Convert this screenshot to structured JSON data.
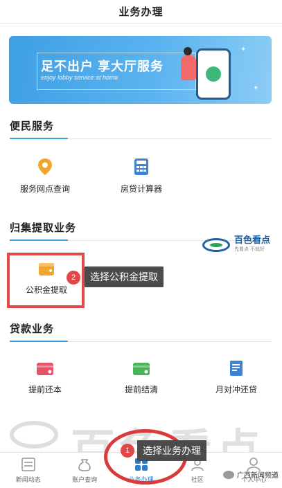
{
  "header": {
    "title": "业务办理"
  },
  "banner": {
    "main_text": "足不出户 享大厅服务",
    "sub_text": "enjoy lobby service at home"
  },
  "sections": {
    "convenience": {
      "title": "便民服务",
      "items": [
        {
          "label": "服务网点查询",
          "icon": "location-pin-icon"
        },
        {
          "label": "房贷计算器",
          "icon": "calculator-icon"
        }
      ]
    },
    "withdraw": {
      "title": "归集提取业务",
      "items": [
        {
          "label": "公积金提取",
          "icon": "wallet-icon"
        }
      ]
    },
    "loan": {
      "title": "贷款业务",
      "items": [
        {
          "label": "提前还本",
          "icon": "card-icon"
        },
        {
          "label": "提前结清",
          "icon": "card-check-icon"
        },
        {
          "label": "月对冲还贷",
          "icon": "document-icon"
        }
      ]
    }
  },
  "annotations": {
    "step2": {
      "number": "2",
      "text": "选择公积金提取"
    },
    "step1": {
      "number": "1",
      "text": "选择业务办理"
    }
  },
  "watermark": {
    "logo_text": "百色看点",
    "logo_sub": "先看点 不就好",
    "big_text": "百色看点",
    "small_text": "百色看点"
  },
  "tabbar": {
    "tabs": [
      {
        "label": "新闻动态",
        "icon": "news-icon",
        "active": false
      },
      {
        "label": "账户查询",
        "icon": "money-bag-icon",
        "active": false
      },
      {
        "label": "业务办理",
        "icon": "grid-icon",
        "active": true
      },
      {
        "label": "社区",
        "icon": "community-icon",
        "active": false
      },
      {
        "label": "个人中心",
        "icon": "person-icon",
        "active": false
      }
    ]
  },
  "footer_brand": {
    "text": "广西新闻频道"
  },
  "colors": {
    "accent": "#3aa3df",
    "highlight": "#e24a4a",
    "tile_orange": "#f0a531",
    "tile_red": "#e6546a",
    "tile_green": "#49b45a",
    "tile_blue": "#3f82d4"
  }
}
